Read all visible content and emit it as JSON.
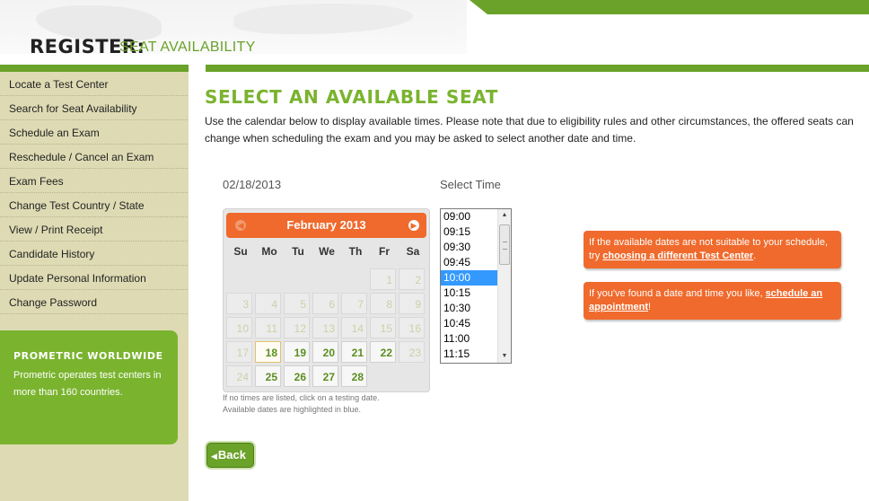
{
  "header": {
    "title": "REGISTER:",
    "subtitle": "SEAT AVAILABILITY"
  },
  "sidebar": {
    "items": [
      {
        "label": "Locate a Test Center"
      },
      {
        "label": "Search for Seat Availability"
      },
      {
        "label": "Schedule an Exam"
      },
      {
        "label": "Reschedule / Cancel an Exam"
      },
      {
        "label": "Exam Fees"
      },
      {
        "label": "Change Test Country / State"
      },
      {
        "label": "View / Print Receipt"
      },
      {
        "label": "Candidate History"
      },
      {
        "label": "Update Personal Information"
      },
      {
        "label": "Change Password"
      }
    ],
    "promo": {
      "title": "PROMETRIC WORLDWIDE",
      "text": "Prometric operates test centers in more than 160 countries."
    }
  },
  "main": {
    "title": "SELECT AN AVAILABLE SEAT",
    "intro": "Use the calendar below to display available times. Please note that due to eligibility rules and other circumstances, the offered seats can change when scheduling the exam and you may be asked to select another date and time.",
    "selected_date": "02/18/2013",
    "select_time_label": "Select Time",
    "calendar": {
      "month_label": "February 2013",
      "prev_icon": "chevron-left-icon",
      "next_icon": "chevron-right-icon",
      "days_of_week": [
        "Su",
        "Mo",
        "Tu",
        "We",
        "Th",
        "Fr",
        "Sa"
      ],
      "weeks": [
        [
          {
            "day": "",
            "state": "empty"
          },
          {
            "day": "",
            "state": "empty"
          },
          {
            "day": "",
            "state": "empty"
          },
          {
            "day": "",
            "state": "empty"
          },
          {
            "day": "",
            "state": "empty"
          },
          {
            "day": "1",
            "state": "unavailable"
          },
          {
            "day": "2",
            "state": "unavailable"
          }
        ],
        [
          {
            "day": "3",
            "state": "unavailable"
          },
          {
            "day": "4",
            "state": "unavailable"
          },
          {
            "day": "5",
            "state": "unavailable"
          },
          {
            "day": "6",
            "state": "unavailable"
          },
          {
            "day": "7",
            "state": "unavailable"
          },
          {
            "day": "8",
            "state": "unavailable"
          },
          {
            "day": "9",
            "state": "unavailable"
          }
        ],
        [
          {
            "day": "10",
            "state": "unavailable"
          },
          {
            "day": "11",
            "state": "unavailable"
          },
          {
            "day": "12",
            "state": "unavailable"
          },
          {
            "day": "13",
            "state": "unavailable"
          },
          {
            "day": "14",
            "state": "unavailable"
          },
          {
            "day": "15",
            "state": "unavailable"
          },
          {
            "day": "16",
            "state": "unavailable"
          }
        ],
        [
          {
            "day": "17",
            "state": "unavailable"
          },
          {
            "day": "18",
            "state": "selected"
          },
          {
            "day": "19",
            "state": "available"
          },
          {
            "day": "20",
            "state": "available"
          },
          {
            "day": "21",
            "state": "available"
          },
          {
            "day": "22",
            "state": "available"
          },
          {
            "day": "23",
            "state": "unavailable"
          }
        ],
        [
          {
            "day": "24",
            "state": "unavailable"
          },
          {
            "day": "25",
            "state": "available"
          },
          {
            "day": "26",
            "state": "available"
          },
          {
            "day": "27",
            "state": "available"
          },
          {
            "day": "28",
            "state": "available"
          },
          {
            "day": "",
            "state": "empty"
          },
          {
            "day": "",
            "state": "empty"
          }
        ]
      ],
      "note_line1": "If no times are listed, click on a testing date.",
      "note_line2": "Available dates are highlighted in blue."
    },
    "times": [
      "09:00",
      "09:15",
      "09:30",
      "09:45",
      "10:00",
      "10:15",
      "10:30",
      "10:45",
      "11:00",
      "11:15"
    ],
    "selected_time": "10:00",
    "tip1": {
      "text": "If the available dates are not suitable to your schedule, try ",
      "link": "choosing a different Test Center",
      "suffix": "."
    },
    "tip2": {
      "text": "If you've found a date and time you like, ",
      "link": "schedule an appointment",
      "suffix": "!"
    },
    "back_label": "Back"
  },
  "colors": {
    "brand_green": "#6aa22a",
    "promo_green": "#7ab32e",
    "accent_orange": "#ef6a2c",
    "sidebar_bg": "#dedbb4",
    "selection_blue": "#3399ff"
  }
}
